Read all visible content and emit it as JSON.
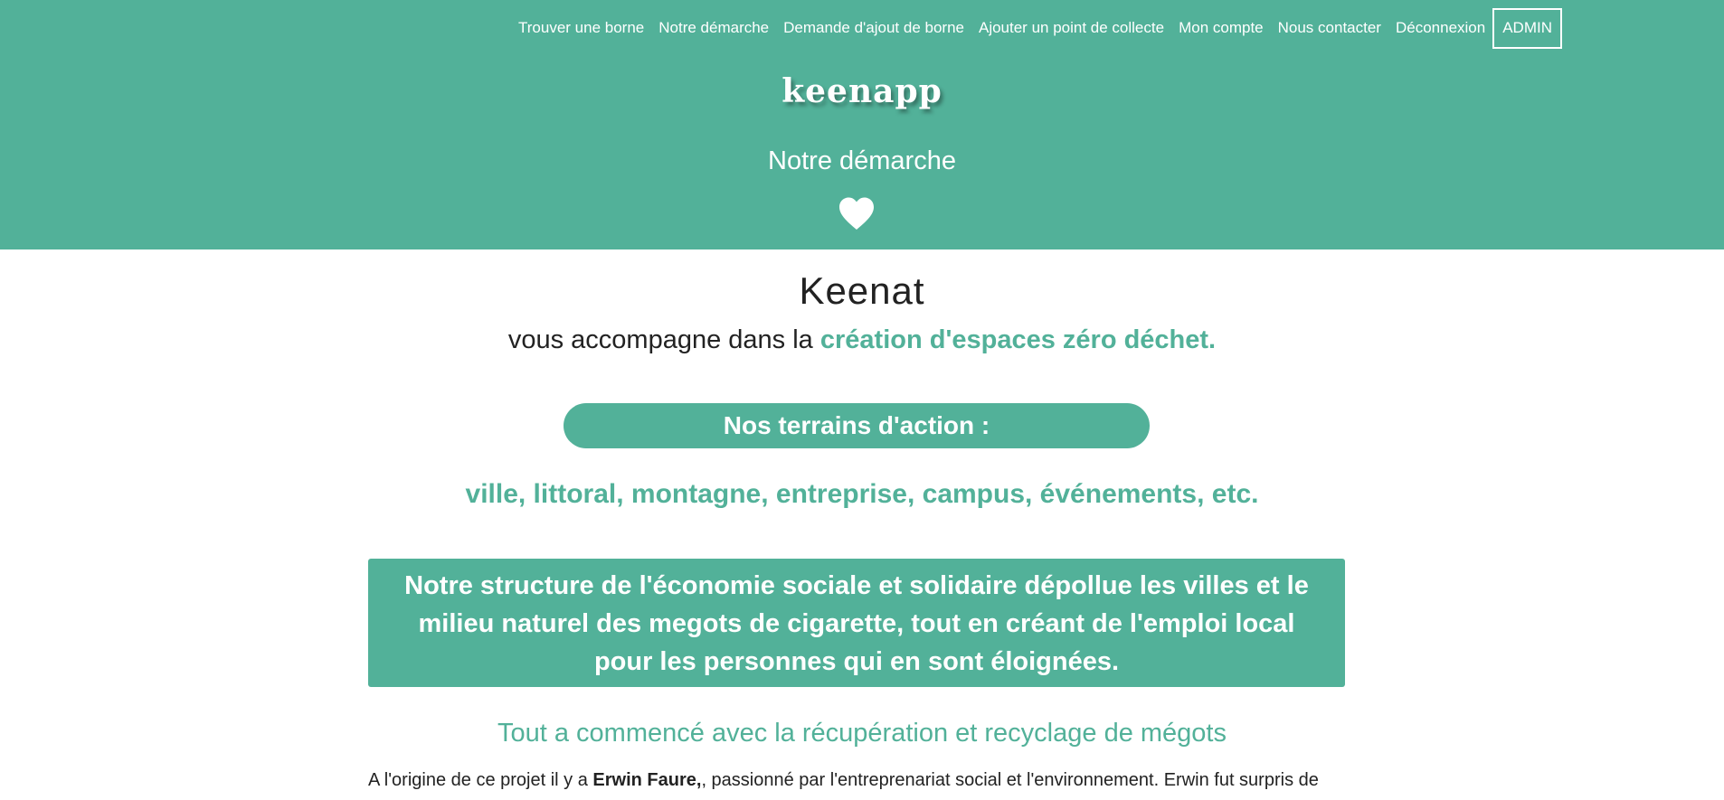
{
  "nav": {
    "links": [
      "Trouver une borne",
      "Notre démarche",
      "Demande d'ajout de borne",
      "Ajouter un point de collecte",
      "Mon compte",
      "Nous contacter",
      "Déconnexion"
    ],
    "admin_label": "ADMIN"
  },
  "header": {
    "logo": "keenapp",
    "subtitle": "Notre démarche",
    "heart_icon": "heart-icon"
  },
  "main": {
    "brand": "Keenat",
    "tagline_prefix": "vous accompagne dans la",
    "tagline_highlight": "création d'espaces zéro déchet.",
    "pill_label": "Nos terrains d'action :",
    "terrains": "ville, littoral, montagne, entreprise, campus, événements, etc.",
    "box_text": "Notre structure de l'économie sociale et solidaire dépollue les villes et le milieu naturel des megots de cigarette, tout en créant de l'emploi local pour les personnes qui en sont éloignées.",
    "section_title": "Tout a commencé avec la récupération et recyclage de mégots",
    "para_before": "A l'origine de ce projet il y a ",
    "para_bold": "Erwin Faure,",
    "para_after": ", passionné par l'entreprenariat social et l'environnement. Erwin fut surpris de"
  },
  "colors": {
    "accent": "#52b199",
    "text": "#222222",
    "white": "#ffffff"
  }
}
